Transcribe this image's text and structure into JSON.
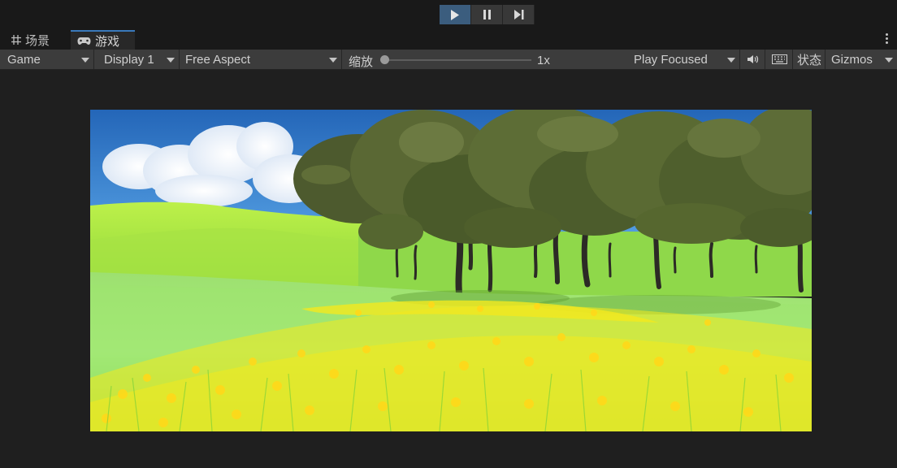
{
  "playbar": {
    "play_active": true,
    "accent": "#3b5d7e",
    "buttons": [
      "play-icon",
      "pause-icon",
      "step-icon"
    ]
  },
  "tabs": [
    {
      "label": "场景",
      "icon": "grid-icon"
    },
    {
      "label": "游戏",
      "icon": "gamepad-icon"
    }
  ],
  "toolbar": {
    "game_mode": "Game",
    "display": "Display 1",
    "aspect": "Free Aspect",
    "scale_label": "缩放",
    "scale_value": "1x",
    "play_focus": "Play Focused",
    "audio_icon": "speaker-icon",
    "stats_icon": "keyboard-icon",
    "stats_label": "状态",
    "gizmos_label": "Gizmos"
  },
  "scene": {
    "description_icon": "landscape-render",
    "sky_color": "#2f6fbd",
    "grass_color": "#9bdc3c",
    "flower_color": "#f3e51f"
  }
}
